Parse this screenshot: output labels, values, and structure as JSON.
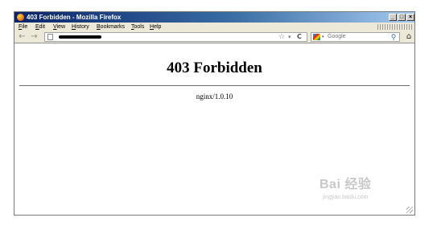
{
  "window": {
    "title": "403 Forbidden - Mozilla Firefox",
    "controls": {
      "minimize": "_",
      "maximize": "□",
      "close": "×"
    }
  },
  "menubar": {
    "items": [
      "File",
      "Edit",
      "View",
      "History",
      "Bookmarks",
      "Tools",
      "Help"
    ]
  },
  "navbar": {
    "back_icon": "←",
    "forward_icon": "→",
    "url_value": "",
    "bookmark_star": "☆",
    "history_dropdown": "▾",
    "reload_icon": "C",
    "search_engine_dropdown": "▾",
    "search_placeholder": "Google",
    "search_go_icon": "⚲",
    "home_icon": "⌂"
  },
  "page": {
    "heading": "403 Forbidden",
    "server_signature": "nginx/1.0.10"
  },
  "watermark": {
    "brand": "Bai 经验",
    "url": "jingyan.baidu.com"
  },
  "colors": {
    "titlebar_start": "#0a246a",
    "titlebar_end": "#a6caf0",
    "chrome": "#ece9d8"
  }
}
